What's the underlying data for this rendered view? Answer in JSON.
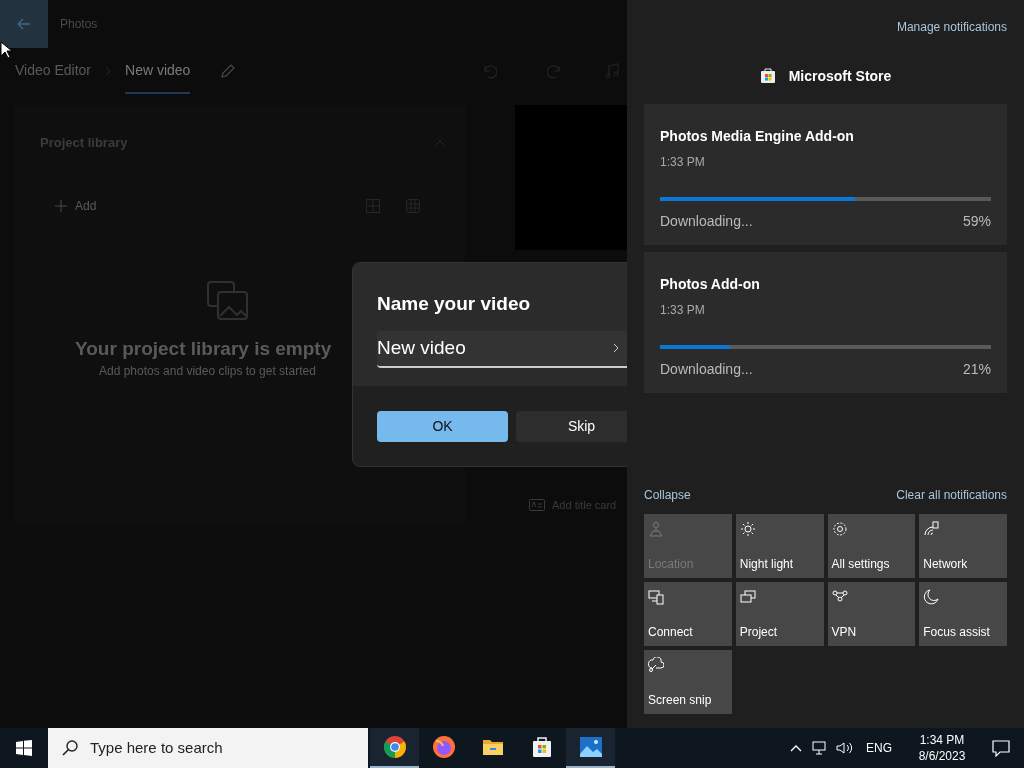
{
  "app": {
    "title": "Photos",
    "breadcrumb": [
      {
        "label": "Video Editor",
        "selected": false
      },
      {
        "label": "New video",
        "selected": true
      }
    ],
    "library": {
      "title": "Project library",
      "add_label": "Add",
      "empty_title": "Your project library is empty",
      "empty_subtitle": "Add photos and video clips to get started"
    },
    "add_title_card": "Add title card"
  },
  "dialog": {
    "title": "Name your video",
    "value": "New video",
    "buttons": [
      {
        "label": "OK",
        "kind": "primary"
      },
      {
        "label": "Skip",
        "kind": "secondary"
      }
    ]
  },
  "action_center": {
    "manage": "Manage notifications",
    "app_name": "Microsoft Store",
    "notifications": [
      {
        "title": "Photos Media Engine Add-on",
        "time": "1:33 PM",
        "status": "Downloading...",
        "percent": "59%",
        "level": 0.59
      },
      {
        "title": "Photos Add-on",
        "time": "1:33 PM",
        "status": "Downloading...",
        "percent": "21%",
        "level": 0.21
      }
    ],
    "collapse": "Collapse",
    "clear_all": "Clear all notifications",
    "quick_actions": [
      {
        "label": "Location",
        "kind": "location",
        "disabled": true
      },
      {
        "label": "Night light",
        "kind": "sun",
        "disabled": false
      },
      {
        "label": "All settings",
        "kind": "gear",
        "disabled": false
      },
      {
        "label": "Network",
        "kind": "network",
        "disabled": false
      },
      {
        "label": "Connect",
        "kind": "connect",
        "disabled": false
      },
      {
        "label": "Project",
        "kind": "project",
        "disabled": false
      },
      {
        "label": "VPN",
        "kind": "vpn",
        "disabled": false
      },
      {
        "label": "Focus assist",
        "kind": "moon",
        "disabled": false
      },
      {
        "label": "Screen snip",
        "kind": "snip",
        "disabled": false
      }
    ]
  },
  "taskbar": {
    "search_placeholder": "Type here to search",
    "apps": [
      {
        "kind": "chrome",
        "running": true
      },
      {
        "kind": "firefox",
        "running": false
      },
      {
        "kind": "folder",
        "running": false
      },
      {
        "kind": "store",
        "running": false
      },
      {
        "kind": "photos",
        "running": true
      }
    ],
    "language": "ENG",
    "time": "1:34 PM",
    "date": "8/6/2023"
  }
}
